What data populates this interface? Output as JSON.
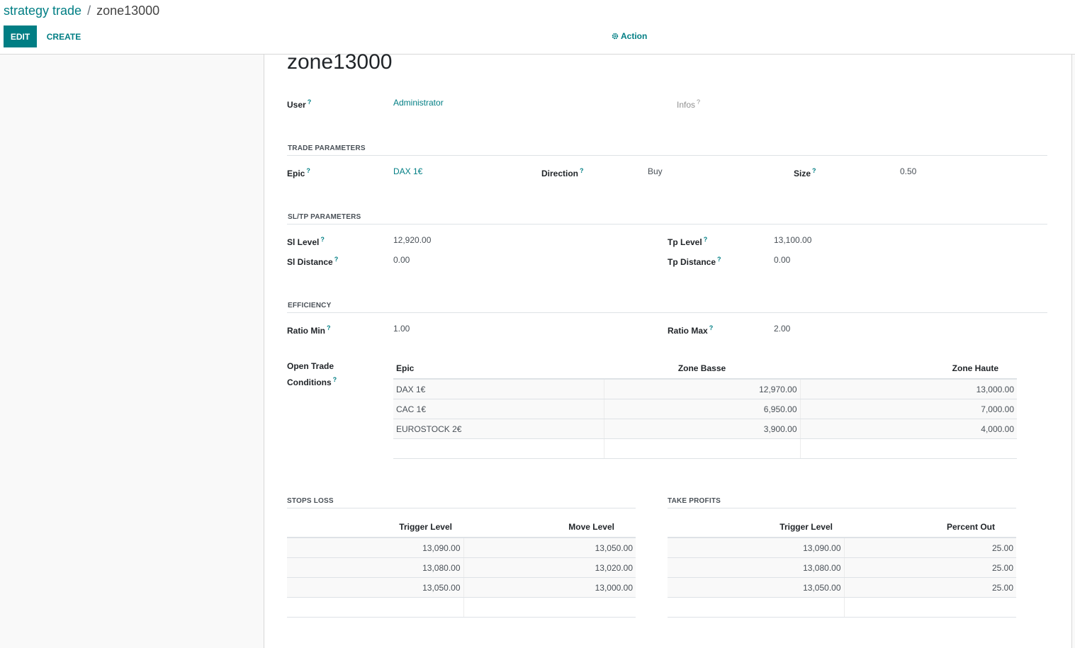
{
  "breadcrumb": {
    "parent": "strategy trade",
    "separator": "/",
    "current": "zone13000"
  },
  "toolbar": {
    "edit_label": "EDIT",
    "create_label": "CREATE",
    "action_label": "Action"
  },
  "record": {
    "name": "zone13000",
    "user_label": "User",
    "user_value": "Administrator",
    "infos_label": "Infos"
  },
  "trade_parameters": {
    "title": "TRADE PARAMETERS",
    "epic_label": "Epic",
    "epic_value": "DAX 1€",
    "direction_label": "Direction",
    "direction_value": "Buy",
    "size_label": "Size",
    "size_value": "0.50"
  },
  "sltp_parameters": {
    "title": "SL/TP PARAMETERS",
    "sl_level_label": "Sl Level",
    "sl_level_value": "12,920.00",
    "sl_distance_label": "Sl Distance",
    "sl_distance_value": "0.00",
    "tp_level_label": "Tp Level",
    "tp_level_value": "13,100.00",
    "tp_distance_label": "Tp Distance",
    "tp_distance_value": "0.00"
  },
  "efficiency": {
    "title": "EFFICIENCY",
    "ratio_min_label": "Ratio Min",
    "ratio_min_value": "1.00",
    "ratio_max_label": "Ratio Max",
    "ratio_max_value": "2.00"
  },
  "open_trade": {
    "label_line1": "Open Trade",
    "label_line2": "Conditions",
    "columns": [
      "Epic",
      "Zone Basse",
      "Zone Haute"
    ],
    "rows": [
      [
        "DAX 1€",
        "12,970.00",
        "13,000.00"
      ],
      [
        "CAC 1€",
        "6,950.00",
        "7,000.00"
      ],
      [
        "EUROSTOCK 2€",
        "3,900.00",
        "4,000.00"
      ]
    ]
  },
  "stops_loss": {
    "title": "STOPS LOSS",
    "columns": [
      "Trigger Level",
      "Move Level"
    ],
    "rows": [
      [
        "13,090.00",
        "13,050.00"
      ],
      [
        "13,080.00",
        "13,020.00"
      ],
      [
        "13,050.00",
        "13,000.00"
      ]
    ]
  },
  "take_profits": {
    "title": "TAKE PROFITS",
    "columns": [
      "Trigger Level",
      "Percent Out"
    ],
    "rows": [
      [
        "13,090.00",
        "25.00"
      ],
      [
        "13,080.00",
        "25.00"
      ],
      [
        "13,050.00",
        "25.00"
      ]
    ]
  },
  "help_marker": "?",
  "colors": {
    "accent": "#017e84",
    "text": "#212529",
    "muted": "#8f8f8f"
  }
}
